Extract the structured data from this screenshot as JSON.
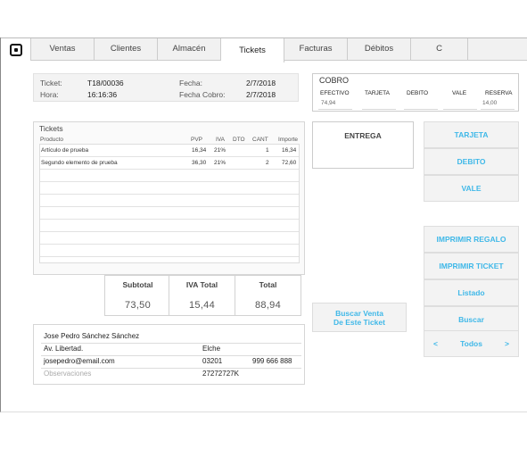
{
  "nav": {
    "tabs": [
      {
        "label": "Ventas"
      },
      {
        "label": "Clientes"
      },
      {
        "label": "Almacén"
      },
      {
        "label": "Tickets"
      },
      {
        "label": "Facturas"
      },
      {
        "label": "Débitos"
      },
      {
        "label": "C"
      }
    ],
    "active_tab": "Tickets"
  },
  "ticket_info": {
    "ticket_label": "Ticket:",
    "ticket_value": "T18/00036",
    "hora_label": "Hora:",
    "hora_value": "16:16:36",
    "fecha_label": "Fecha:",
    "fecha_value": "2/7/2018",
    "fecha_cobro_label": "Fecha Cobro:",
    "fecha_cobro_value": "2/7/2018"
  },
  "cobro": {
    "title": "COBRO",
    "headers": [
      "EFECTIVO",
      "TARJETA",
      "DEBITO",
      "VALE",
      "RESERVA"
    ],
    "values": [
      "74,94",
      "",
      "",
      "",
      "14,00"
    ]
  },
  "tickets": {
    "title": "Tickets",
    "columns": [
      "Producto",
      "PVP",
      "IVA",
      "DTO",
      "CANT",
      "Importe"
    ],
    "rows": [
      {
        "producto": "Artículo de prueba",
        "pvp": "16,34",
        "iva": "21%",
        "dto": "",
        "cant": "1",
        "importe": "16,34"
      },
      {
        "producto": "Segundo elemento de prueba",
        "pvp": "36,30",
        "iva": "21%",
        "dto": "",
        "cant": "2",
        "importe": "72,60"
      }
    ]
  },
  "totals": {
    "subtotal_label": "Subtotal",
    "subtotal_value": "73,50",
    "iva_label": "IVA Total",
    "iva_value": "15,44",
    "total_label": "Total",
    "total_value": "88,94"
  },
  "customer": {
    "name": "Jose Pedro Sánchez Sánchez",
    "address": "Av. Libertad.",
    "city": "Elche",
    "email": "josepedro@email.com",
    "postal_code": "03201",
    "phone": "999 666 888",
    "observations_placeholder": "Observaciones",
    "nif": "27272727K"
  },
  "entrega": {
    "label": "ENTREGA"
  },
  "buscar_venta": {
    "line1": "Buscar Venta",
    "line2": "De Este Ticket"
  },
  "right_buttons": {
    "tarjeta": "TARJETA",
    "debito": "DEBITO",
    "vale": "VALE",
    "imprimir_regalo": "IMPRIMIR REGALO",
    "imprimir_ticket": "IMPRIMIR TICKET",
    "listado": "Listado",
    "buscar": "Buscar",
    "prev": "<",
    "todos": "Todos",
    "next": ">"
  },
  "colors": {
    "accent": "#3fb8e8"
  }
}
